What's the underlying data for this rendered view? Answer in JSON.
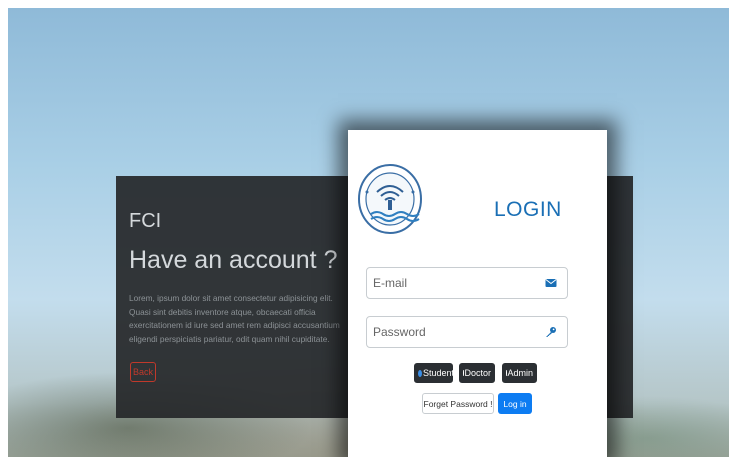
{
  "left_card": {
    "brand": "FCI",
    "headline": "Have an account ?",
    "description": "Lorem, ipsum dolor sit amet consectetur adipisicing elit. Quasi sint debitis inventore atque, obcaecati officia exercitationem id iure sed amet rem adipisci accusantium eligendi perspiciatis pariatur, odit quam nihil cupiditate.",
    "back_label": "Back"
  },
  "login": {
    "logo_icon": "faculty-seal-logo",
    "title": "LOGIN",
    "email": {
      "placeholder": "E-mail",
      "value": "",
      "icon": "envelope-icon"
    },
    "password": {
      "placeholder": "Password",
      "value": "",
      "icon": "key-icon"
    },
    "roles": [
      {
        "label": "Student",
        "selected": true
      },
      {
        "label": "Doctor",
        "selected": false
      },
      {
        "label": "Admin",
        "selected": false
      }
    ],
    "forget_label": "Forget Password !",
    "login_label": "Log in"
  },
  "colors": {
    "title_blue": "#1a6fb5",
    "primary_button": "#0d7cf2",
    "back_red": "#c0392b",
    "dark_card": "#26282a"
  }
}
